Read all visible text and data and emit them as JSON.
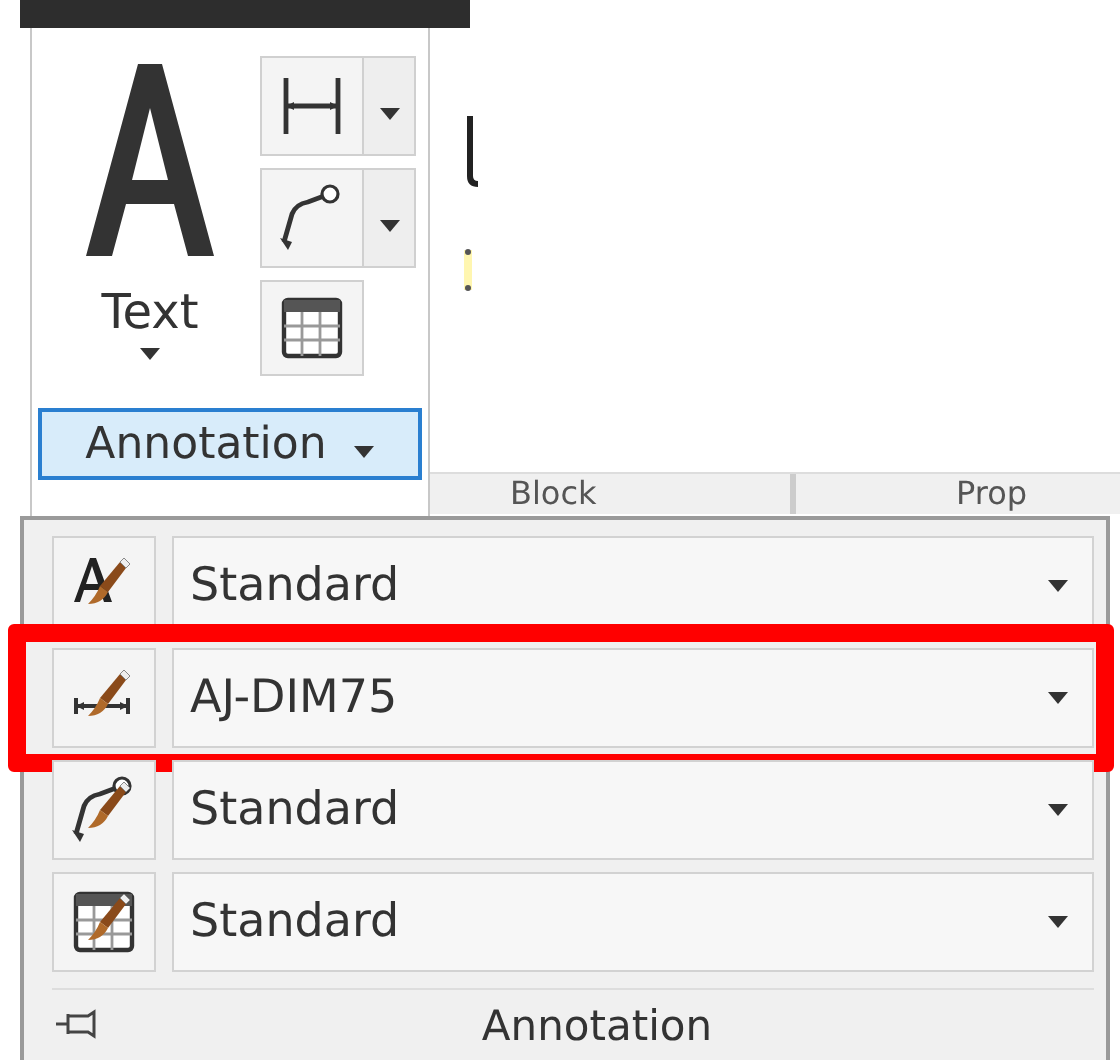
{
  "ribbon_panel": {
    "text_button": {
      "label": "Text"
    },
    "tools": [
      {
        "kind": "dimension",
        "split": true
      },
      {
        "kind": "leader",
        "split": true
      },
      {
        "kind": "table",
        "split": false
      }
    ],
    "panel_button": {
      "label": "Annotation",
      "selected": true
    }
  },
  "tab_labels": [
    "Block",
    "Prop"
  ],
  "expanded_panel": {
    "rows": [
      {
        "kind": "text",
        "value": "Standard",
        "highlighted": false
      },
      {
        "kind": "dimension",
        "value": "AJ-DIM75",
        "highlighted": true
      },
      {
        "kind": "leader",
        "value": "Standard",
        "highlighted": false
      },
      {
        "kind": "table",
        "value": "Standard",
        "highlighted": false
      }
    ],
    "footer": {
      "label": "Annotation",
      "pinned": false
    }
  }
}
